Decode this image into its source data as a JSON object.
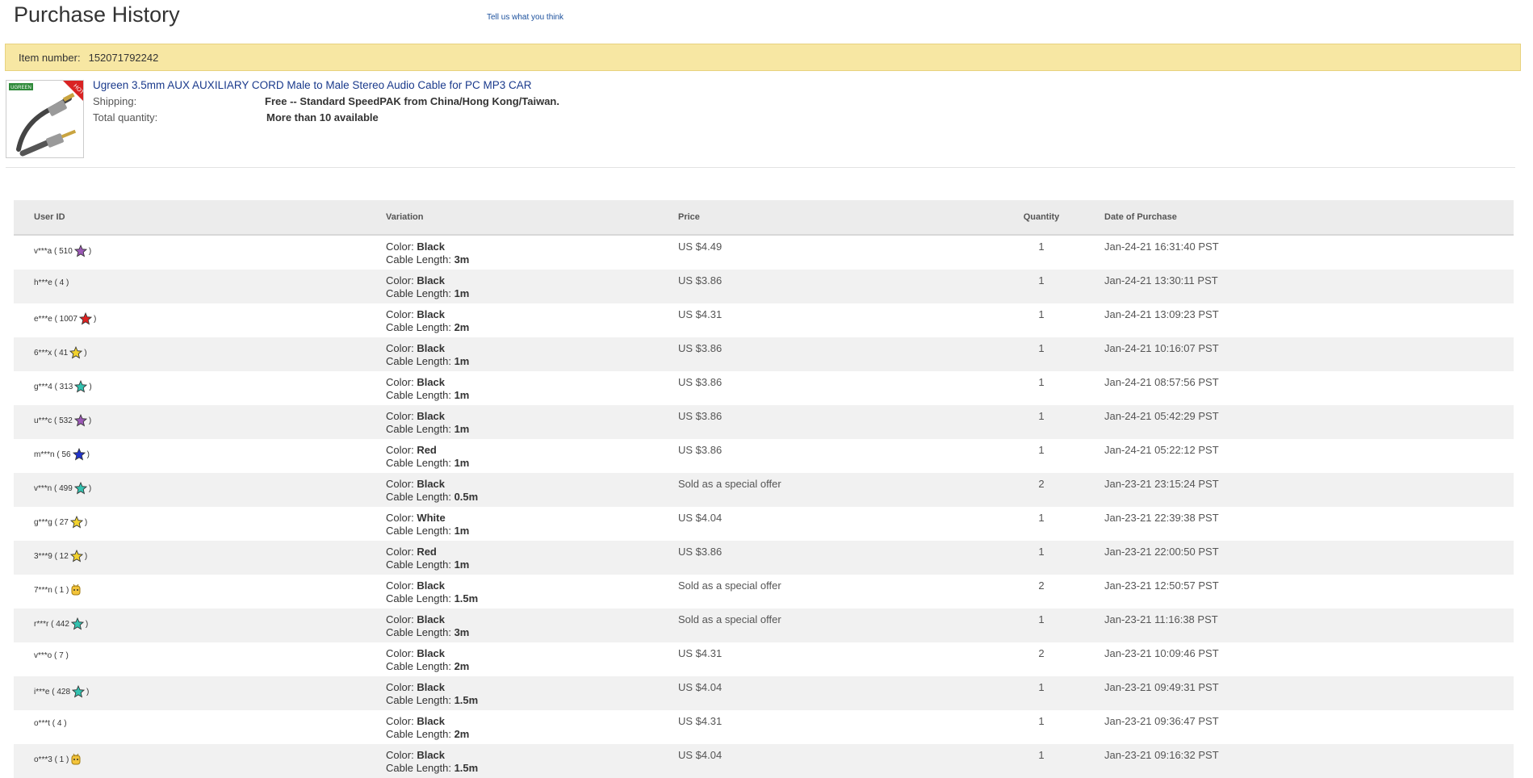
{
  "header": {
    "title": "Purchase History",
    "feedback_link": "Tell us what you think"
  },
  "item": {
    "number_label": "Item number:",
    "number": "152071792242",
    "title": "Ugreen 3.5mm AUX AUXILIARY CORD Male to Male Stereo Audio Cable for PC MP3 CAR",
    "shipping_label": "Shipping:",
    "shipping_value": "Free -- Standard SpeedPAK from China/Hong Kong/Taiwan.",
    "quantity_label": "Total quantity:",
    "quantity_value": "More than 10 available",
    "thumb_brand": "UGREEN",
    "thumb_badge": "HOT"
  },
  "table": {
    "columns": [
      "User ID",
      "Variation",
      "Price",
      "Quantity",
      "Date of Purchase"
    ],
    "color_label": "Color:",
    "length_label": "Cable Length:",
    "rows": [
      {
        "user": "v***a ( 510",
        "star": "purple",
        "color": "Black",
        "length": "3m",
        "price": "US $4.49",
        "qty": "1",
        "date": "Jan-24-21 16:31:40 PST"
      },
      {
        "user": "h***e ( 4 )",
        "star": "",
        "color": "Black",
        "length": "1m",
        "price": "US $3.86",
        "qty": "1",
        "date": "Jan-24-21 13:30:11 PST"
      },
      {
        "user": "e***e ( 1007",
        "star": "red",
        "color": "Black",
        "length": "2m",
        "price": "US $4.31",
        "qty": "1",
        "date": "Jan-24-21 13:09:23 PST"
      },
      {
        "user": "6***x ( 41",
        "star": "yellow",
        "color": "Black",
        "length": "1m",
        "price": "US $3.86",
        "qty": "1",
        "date": "Jan-24-21 10:16:07 PST"
      },
      {
        "user": "g***4 ( 313",
        "star": "teal",
        "color": "Black",
        "length": "1m",
        "price": "US $3.86",
        "qty": "1",
        "date": "Jan-24-21 08:57:56 PST"
      },
      {
        "user": "u***c ( 532",
        "star": "purple",
        "color": "Black",
        "length": "1m",
        "price": "US $3.86",
        "qty": "1",
        "date": "Jan-24-21 05:42:29 PST"
      },
      {
        "user": "m***n ( 56",
        "star": "blue",
        "color": "Red",
        "length": "1m",
        "price": "US $3.86",
        "qty": "1",
        "date": "Jan-24-21 05:22:12 PST"
      },
      {
        "user": "v***n ( 499",
        "star": "teal",
        "color": "Black",
        "length": "0.5m",
        "price": "Sold as a special offer",
        "qty": "2",
        "date": "Jan-23-21 23:15:24 PST"
      },
      {
        "user": "g***g ( 27",
        "star": "yellow",
        "color": "White",
        "length": "1m",
        "price": "US $4.04",
        "qty": "1",
        "date": "Jan-23-21 22:39:38 PST"
      },
      {
        "user": "3***9 ( 12",
        "star": "yellow",
        "color": "Red",
        "length": "1m",
        "price": "US $3.86",
        "qty": "1",
        "date": "Jan-23-21 22:00:50 PST"
      },
      {
        "user": "7***n ( 1 )",
        "star": "new",
        "color": "Black",
        "length": "1.5m",
        "price": "Sold as a special offer",
        "qty": "2",
        "date": "Jan-23-21 12:50:57 PST"
      },
      {
        "user": "r***r ( 442",
        "star": "teal",
        "color": "Black",
        "length": "3m",
        "price": "Sold as a special offer",
        "qty": "1",
        "date": "Jan-23-21 11:16:38 PST"
      },
      {
        "user": "v***o ( 7 )",
        "star": "",
        "color": "Black",
        "length": "2m",
        "price": "US $4.31",
        "qty": "2",
        "date": "Jan-23-21 10:09:46 PST"
      },
      {
        "user": "i***e ( 428",
        "star": "teal",
        "color": "Black",
        "length": "1.5m",
        "price": "US $4.04",
        "qty": "1",
        "date": "Jan-23-21 09:49:31 PST"
      },
      {
        "user": "o***t ( 4 )",
        "star": "",
        "color": "Black",
        "length": "2m",
        "price": "US $4.31",
        "qty": "1",
        "date": "Jan-23-21 09:36:47 PST"
      },
      {
        "user": "o***3 ( 1 )",
        "star": "new",
        "color": "Black",
        "length": "1.5m",
        "price": "US $4.04",
        "qty": "1",
        "date": "Jan-23-21 09:16:32 PST"
      }
    ]
  },
  "star_colors": {
    "purple": "#9b59b6",
    "red": "#e02020",
    "yellow": "#f2d22e",
    "teal": "#33c2b0",
    "blue": "#2233cc"
  }
}
